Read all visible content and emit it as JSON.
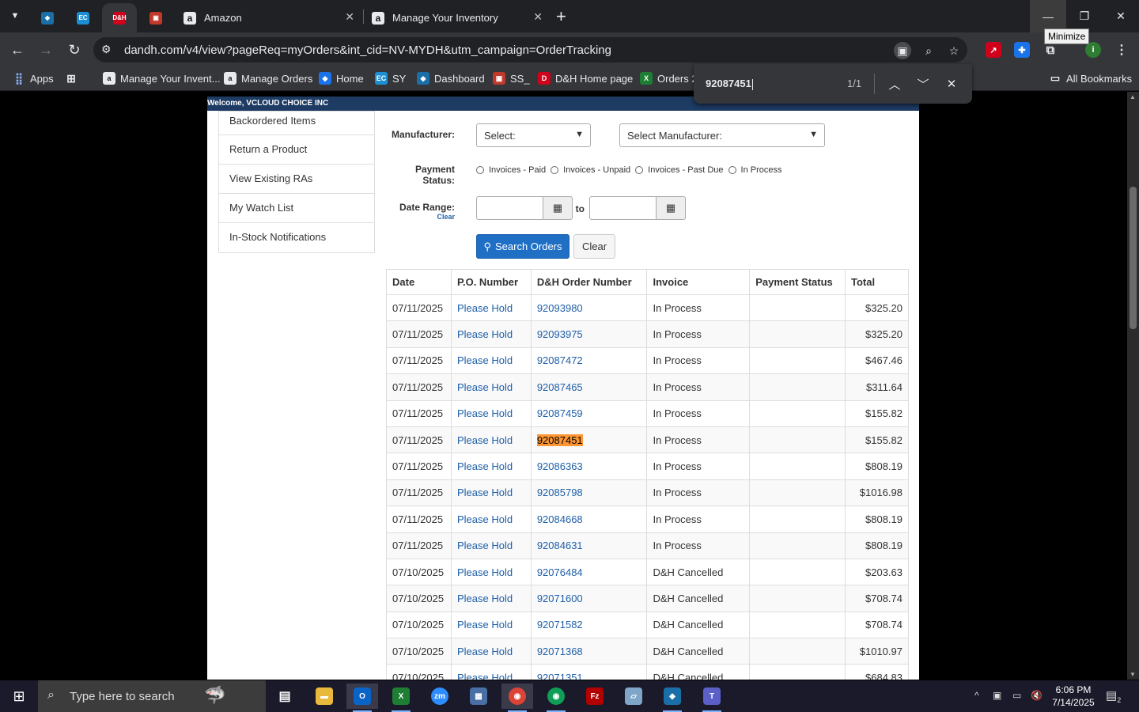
{
  "browser": {
    "tabs": [
      {
        "label": "Amazon"
      },
      {
        "label": "Manage Your Inventory"
      }
    ],
    "url": "dandh.com/v4/view?pageReq=myOrders&int_cid=NV-MYDH&utm_campaign=OrderTracking",
    "tooltip": "Minimize",
    "bookmarks": [
      {
        "label": "Apps"
      },
      {
        "label": "Manage Your Invent..."
      },
      {
        "label": "Manage Orders"
      },
      {
        "label": "Home"
      },
      {
        "label": "SY"
      },
      {
        "label": "Dashboard"
      },
      {
        "label": "SS_"
      },
      {
        "label": "D&H Home page"
      },
      {
        "label": "Orders 2"
      },
      {
        "label": "All Bookmarks"
      }
    ],
    "find": {
      "query": "92087451",
      "count": "1/1"
    }
  },
  "page": {
    "welcome": "Welcome, VCLOUD CHOICE INC",
    "sidebar": [
      {
        "label": "Backordered Items"
      },
      {
        "label": "Return a Product"
      },
      {
        "label": "View Existing RAs"
      },
      {
        "label": "My Watch List"
      },
      {
        "label": "In-Stock Notifications"
      }
    ],
    "form": {
      "manufacturer_label": "Manufacturer:",
      "manufacturer_select": "Select:",
      "manufacturer_select2": "Select Manufacturer:",
      "payment_label": "Payment Status:",
      "payment_options": [
        "Invoices - Paid",
        "Invoices - Unpaid",
        "Invoices - Past Due",
        "In Process"
      ],
      "date_label": "Date Range:",
      "date_clear": "Clear",
      "date_to": "to",
      "search_button": "Search Orders",
      "clear_button": "Clear"
    },
    "table": {
      "headers": [
        "Date",
        "P.O. Number",
        "D&H Order Number",
        "Invoice",
        "Payment Status",
        "Total"
      ],
      "rows": [
        {
          "date": "07/11/2025",
          "po": "Please Hold",
          "order": "92093980",
          "invoice": "In Process",
          "payment": "",
          "total": "$325.20"
        },
        {
          "date": "07/11/2025",
          "po": "Please Hold",
          "order": "92093975",
          "invoice": "In Process",
          "payment": "",
          "total": "$325.20"
        },
        {
          "date": "07/11/2025",
          "po": "Please Hold",
          "order": "92087472",
          "invoice": "In Process",
          "payment": "",
          "total": "$467.46"
        },
        {
          "date": "07/11/2025",
          "po": "Please Hold",
          "order": "92087465",
          "invoice": "In Process",
          "payment": "",
          "total": "$311.64"
        },
        {
          "date": "07/11/2025",
          "po": "Please Hold",
          "order": "92087459",
          "invoice": "In Process",
          "payment": "",
          "total": "$155.82"
        },
        {
          "date": "07/11/2025",
          "po": "Please Hold",
          "order": "92087451",
          "invoice": "In Process",
          "payment": "",
          "total": "$155.82",
          "highlight": true
        },
        {
          "date": "07/11/2025",
          "po": "Please Hold",
          "order": "92086363",
          "invoice": "In Process",
          "payment": "",
          "total": "$808.19"
        },
        {
          "date": "07/11/2025",
          "po": "Please Hold",
          "order": "92085798",
          "invoice": "In Process",
          "payment": "",
          "total": "$1016.98"
        },
        {
          "date": "07/11/2025",
          "po": "Please Hold",
          "order": "92084668",
          "invoice": "In Process",
          "payment": "",
          "total": "$808.19"
        },
        {
          "date": "07/11/2025",
          "po": "Please Hold",
          "order": "92084631",
          "invoice": "In Process",
          "payment": "",
          "total": "$808.19"
        },
        {
          "date": "07/10/2025",
          "po": "Please Hold",
          "order": "92076484",
          "invoice": "D&H Cancelled",
          "payment": "",
          "total": "$203.63"
        },
        {
          "date": "07/10/2025",
          "po": "Please Hold",
          "order": "92071600",
          "invoice": "D&H Cancelled",
          "payment": "",
          "total": "$708.74"
        },
        {
          "date": "07/10/2025",
          "po": "Please Hold",
          "order": "92071582",
          "invoice": "D&H Cancelled",
          "payment": "",
          "total": "$708.74"
        },
        {
          "date": "07/10/2025",
          "po": "Please Hold",
          "order": "92071368",
          "invoice": "D&H Cancelled",
          "payment": "",
          "total": "$1010.97"
        },
        {
          "date": "07/10/2025",
          "po": "Please Hold",
          "order": "92071351",
          "invoice": "D&H Cancelled",
          "payment": "",
          "total": "$684.83"
        }
      ]
    }
  },
  "taskbar": {
    "search_placeholder": "Type here to search",
    "time": "6:06 PM",
    "date": "7/14/2025",
    "notifications": "2"
  }
}
